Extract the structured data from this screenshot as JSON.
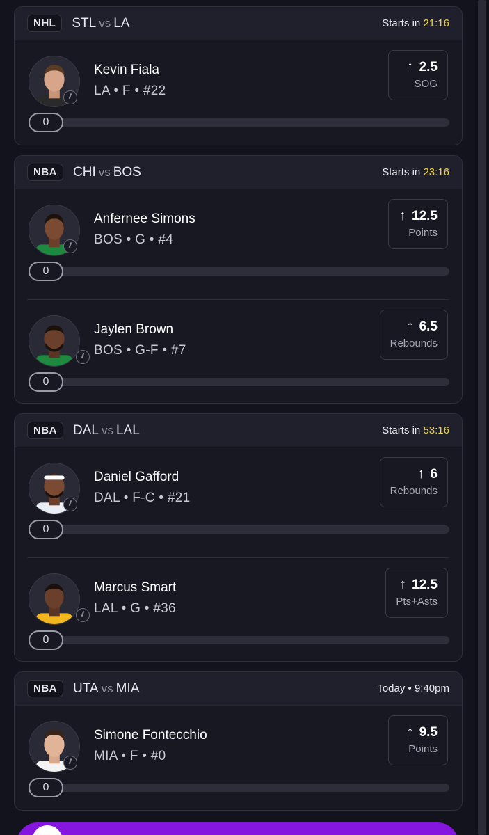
{
  "games": [
    {
      "league": "NHL",
      "home": "STL",
      "vs": "vs",
      "away": "LA",
      "start_prefix": "Starts in",
      "start_time": "21:16",
      "players": [
        {
          "name": "Kevin Fiala",
          "meta": "LA • F • #22",
          "line": "2.5",
          "stat": "SOG",
          "progress": "0",
          "jersey": "#2a2a2a"
        }
      ]
    },
    {
      "league": "NBA",
      "home": "CHI",
      "vs": "vs",
      "away": "BOS",
      "start_prefix": "Starts in",
      "start_time": "23:16",
      "players": [
        {
          "name": "Anfernee Simons",
          "meta": "BOS • G • #4",
          "line": "12.5",
          "stat": "Points",
          "progress": "0",
          "jersey": "#1d8a3f"
        },
        {
          "name": "Jaylen Brown",
          "meta": "BOS • G-F • #7",
          "line": "6.5",
          "stat": "Rebounds",
          "progress": "0",
          "jersey": "#1d8a3f"
        }
      ]
    },
    {
      "league": "NBA",
      "home": "DAL",
      "vs": "vs",
      "away": "LAL",
      "start_prefix": "Starts in",
      "start_time": "53:16",
      "players": [
        {
          "name": "Daniel Gafford",
          "meta": "DAL • F-C • #21",
          "line": "6",
          "stat": "Rebounds",
          "progress": "0",
          "jersey": "#e9eef5"
        },
        {
          "name": "Marcus Smart",
          "meta": "LAL • G • #36",
          "line": "12.5",
          "stat": "Pts+Asts",
          "progress": "0",
          "jersey": "#f2b71e"
        }
      ]
    },
    {
      "league": "NBA",
      "home": "UTA",
      "vs": "vs",
      "away": "MIA",
      "start_prefix": "",
      "start_time": "Today • 9:40pm",
      "players": [
        {
          "name": "Simone Fontecchio",
          "meta": "MIA • F • #0",
          "line": "9.5",
          "stat": "Points",
          "progress": "0",
          "jersey": "#f3f3f3"
        }
      ]
    }
  ],
  "colors": {
    "accent_time": "#f1d33a",
    "button": "#8416e0"
  },
  "icons": {
    "prop_direction": "arrow-up-icon",
    "clock": "clock-icon"
  }
}
